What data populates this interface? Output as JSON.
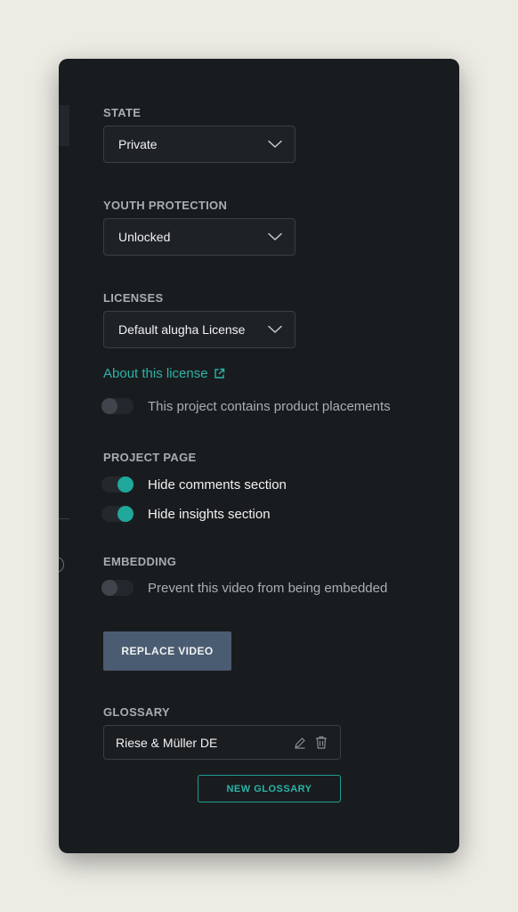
{
  "state": {
    "label": "STATE",
    "value": "Private"
  },
  "youth_protection": {
    "label": "YOUTH PROTECTION",
    "value": "Unlocked"
  },
  "licenses": {
    "label": "LICENSES",
    "value": "Default alugha License",
    "about_link": "About this license",
    "product_placement": {
      "label": "This project contains product placements",
      "on": false
    }
  },
  "project_page": {
    "label": "PROJECT PAGE",
    "hide_comments": {
      "label": "Hide comments section",
      "on": true
    },
    "hide_insights": {
      "label": "Hide insights section",
      "on": true
    }
  },
  "embedding": {
    "label": "EMBEDDING",
    "prevent_embed": {
      "label": "Prevent this video from being embedded",
      "on": false
    }
  },
  "replace_video_label": "REPLACE VIDEO",
  "glossary": {
    "label": "GLOSSARY",
    "items": [
      {
        "name": "Riese & Müller DE"
      }
    ],
    "new_label": "NEW GLOSSARY"
  },
  "colors": {
    "accent": "#1fa89b",
    "panel_bg": "#191c1f",
    "page_bg": "#ecebe4",
    "button_bg": "#4a5c71"
  },
  "icons": [
    "chevron-down-icon",
    "external-link-icon",
    "pencil-icon",
    "trash-icon"
  ]
}
